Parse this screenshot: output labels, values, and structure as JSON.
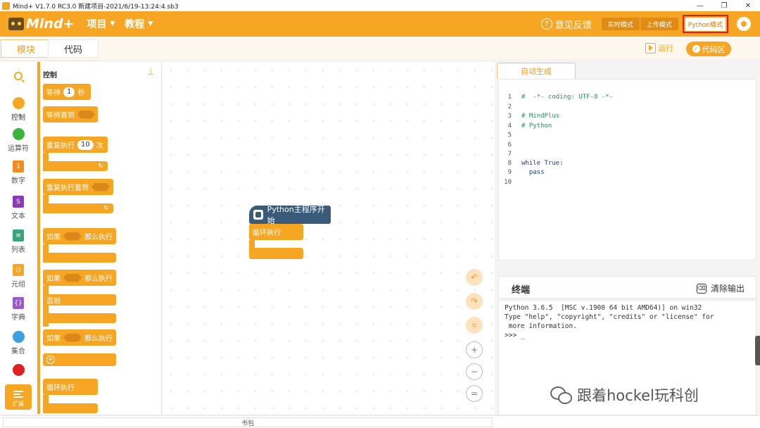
{
  "window": {
    "title": "Mind+ V1.7.0 RC3.0   新建项目-2021/6/19-13:24:4.sb3",
    "controls": [
      "—",
      "❐",
      "✕"
    ]
  },
  "menubar": {
    "logo_text": "Mind+",
    "menus": [
      {
        "label": "项目"
      },
      {
        "label": "教程"
      }
    ],
    "feedback": "意见反馈",
    "modes": [
      "实时模式",
      "上传模式"
    ],
    "python_mode": "Python模式"
  },
  "tabs": {
    "blocks": "模块",
    "code": "代码",
    "run": "运行",
    "code_area": "代码区"
  },
  "categories": [
    {
      "label": "控制",
      "color": "#f6a623"
    },
    {
      "label": "运算符",
      "color": "#3cb43c"
    },
    {
      "label": "数字",
      "color": "#f28c1e"
    },
    {
      "label": "文本",
      "color": "#8a3ab9"
    },
    {
      "label": "列表",
      "color": "#3aa37a"
    },
    {
      "label": "元组",
      "color": "#f6a623"
    },
    {
      "label": "字典",
      "color": "#9c59c9"
    },
    {
      "label": "集合",
      "color": "#3ea0e0"
    },
    {
      "label": "",
      "color": "#e02020"
    }
  ],
  "extension_label": "扩展",
  "palette": {
    "title": "控制",
    "wait_label": "等待",
    "wait_value": "1",
    "wait_unit": "秒",
    "wait_until": "等待直到",
    "repeat_label": "重复执行",
    "repeat_value": "10",
    "repeat_unit": "次",
    "repeat_until": "重复执行直到",
    "if_label": "如果",
    "then_label": "那么执行",
    "if2_label": "如果",
    "then2_label": "那么执行",
    "else_label": "否则",
    "if3_label": "如果",
    "then3_label": "那么执行",
    "loop_label": "循环执行"
  },
  "workspace": {
    "hat_label": "Python主程序开始",
    "loop_label": "循环执行"
  },
  "backpack": "书包",
  "code_panel": {
    "tab": "自动生成",
    "lines": [
      {
        "n": "1",
        "t": "#  -*- coding: UTF-8 -*-",
        "cls": "comment"
      },
      {
        "n": "2",
        "t": "",
        "cls": ""
      },
      {
        "n": "3",
        "t": "# MindPlus",
        "cls": "comment"
      },
      {
        "n": "4",
        "t": "# Python",
        "cls": "comment"
      },
      {
        "n": "5",
        "t": "",
        "cls": ""
      },
      {
        "n": "6",
        "t": "",
        "cls": ""
      },
      {
        "n": "7",
        "t": "",
        "cls": ""
      },
      {
        "n": "8",
        "t": "while True:",
        "cls": "kw"
      },
      {
        "n": "9",
        "t": "  pass",
        "cls": "kw"
      },
      {
        "n": "10",
        "t": "",
        "cls": ""
      }
    ]
  },
  "terminal": {
    "title": "终端",
    "clear": "清除输出",
    "lines": [
      "Python 3.6.5  [MSC v.1900 64 bit AMD64)] on win32",
      "Type \"help\", \"copyright\", \"credits\" or \"license\" for",
      " more information.",
      ">>> _"
    ]
  },
  "watermark": "跟着hockel玩科创"
}
